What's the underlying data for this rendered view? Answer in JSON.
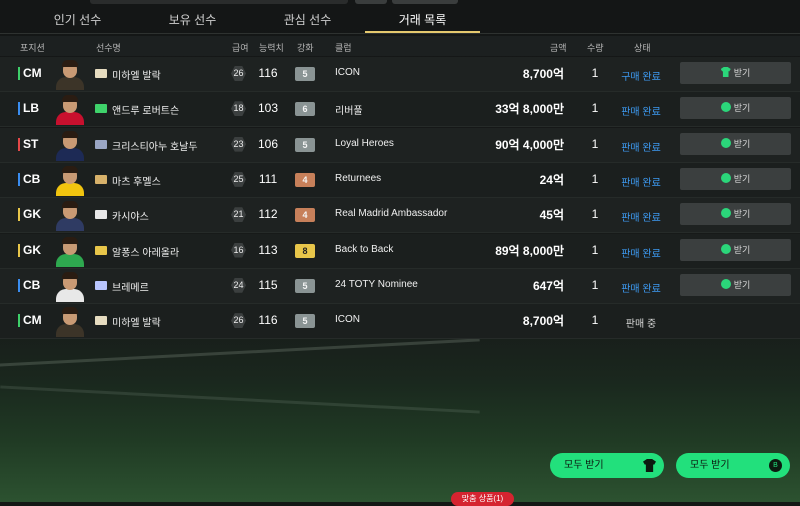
{
  "tabs": [
    {
      "label": "인기 선수",
      "active": false
    },
    {
      "label": "보유 선수",
      "active": false
    },
    {
      "label": "관심 선수",
      "active": false
    },
    {
      "label": "거래 목록",
      "active": true
    }
  ],
  "columns": {
    "position": "포지션",
    "player": "선수명",
    "salary": "급여",
    "ovr": "능력치",
    "enhance": "강화",
    "club": "클럽",
    "price": "금액",
    "qty": "수량",
    "status": "상태"
  },
  "rows": [
    {
      "pos": "CM",
      "pos_color": "g",
      "season": "ICON",
      "name": "미하엘 발락",
      "salary": "26",
      "ovr": "116",
      "enh": "5",
      "enh_color": "#8a9494",
      "club": "ICON",
      "price": "8,700억",
      "qty": "1",
      "status": "구매 완료",
      "status_style": "blue",
      "button": {
        "label": "받기",
        "icon": "shirt-icon"
      }
    },
    {
      "pos": "LB",
      "pos_color": "b",
      "season": "23PL",
      "name": "앤드루 로버트슨",
      "salary": "18",
      "ovr": "103",
      "enh": "6",
      "enh_color": "#8a9494",
      "club": "리버풀",
      "price": "33억 8,000만",
      "qty": "1",
      "status": "판매 완료",
      "status_style": "blue",
      "button": {
        "label": "받기",
        "icon": "coin-icon"
      }
    },
    {
      "pos": "ST",
      "pos_color": "r",
      "season": "LH",
      "name": "크리스티아누 호날두",
      "salary": "23",
      "ovr": "106",
      "enh": "5",
      "enh_color": "#8a9494",
      "club": "Loyal Heroes",
      "price": "90억 4,000만",
      "qty": "1",
      "status": "판매 완료",
      "status_style": "blue",
      "button": {
        "label": "받기",
        "icon": "coin-icon"
      }
    },
    {
      "pos": "CB",
      "pos_color": "b",
      "season": "RTN",
      "name": "마츠 후멜스",
      "salary": "25",
      "ovr": "111",
      "enh": "4",
      "enh_color": "#c7805a",
      "club": "Returnees",
      "price": "24억",
      "qty": "1",
      "status": "판매 완료",
      "status_style": "blue",
      "button": {
        "label": "받기",
        "icon": "coin-icon"
      }
    },
    {
      "pos": "GK",
      "pos_color": "y",
      "season": "RMA",
      "name": "카시야스",
      "salary": "21",
      "ovr": "112",
      "enh": "4",
      "enh_color": "#c7805a",
      "club": "Real Madrid Ambassador",
      "price": "45억",
      "qty": "1",
      "status": "판매 완료",
      "status_style": "blue",
      "button": {
        "label": "받기",
        "icon": "coin-icon"
      }
    },
    {
      "pos": "GK",
      "pos_color": "y",
      "season": "BTB",
      "name": "알퐁스 아레올라",
      "salary": "16",
      "ovr": "113",
      "enh": "8",
      "enh_color": "#e8c64a",
      "club": "Back to Back",
      "price": "89억 8,000만",
      "qty": "1",
      "status": "판매 완료",
      "status_style": "blue",
      "button": {
        "label": "받기",
        "icon": "coin-icon"
      }
    },
    {
      "pos": "CB",
      "pos_color": "b",
      "season": "24TY",
      "name": "브레메르",
      "salary": "24",
      "ovr": "115",
      "enh": "5",
      "enh_color": "#8a9494",
      "club": "24 TOTY Nominee",
      "price": "647억",
      "qty": "1",
      "status": "판매 완료",
      "status_style": "blue",
      "button": {
        "label": "받기",
        "icon": "coin-icon"
      }
    },
    {
      "pos": "CM",
      "pos_color": "g",
      "season": "ICON",
      "name": "미하엘 발락",
      "salary": "26",
      "ovr": "116",
      "enh": "5",
      "enh_color": "#8a9494",
      "club": "ICON",
      "price": "8,700억",
      "qty": "1",
      "status": "판매 중",
      "status_style": "plain",
      "button": null
    }
  ],
  "footer": {
    "receive_all_players": "모두 받기",
    "receive_all_bp": "모두 받기",
    "notice": "맞춤 상품(1)"
  }
}
